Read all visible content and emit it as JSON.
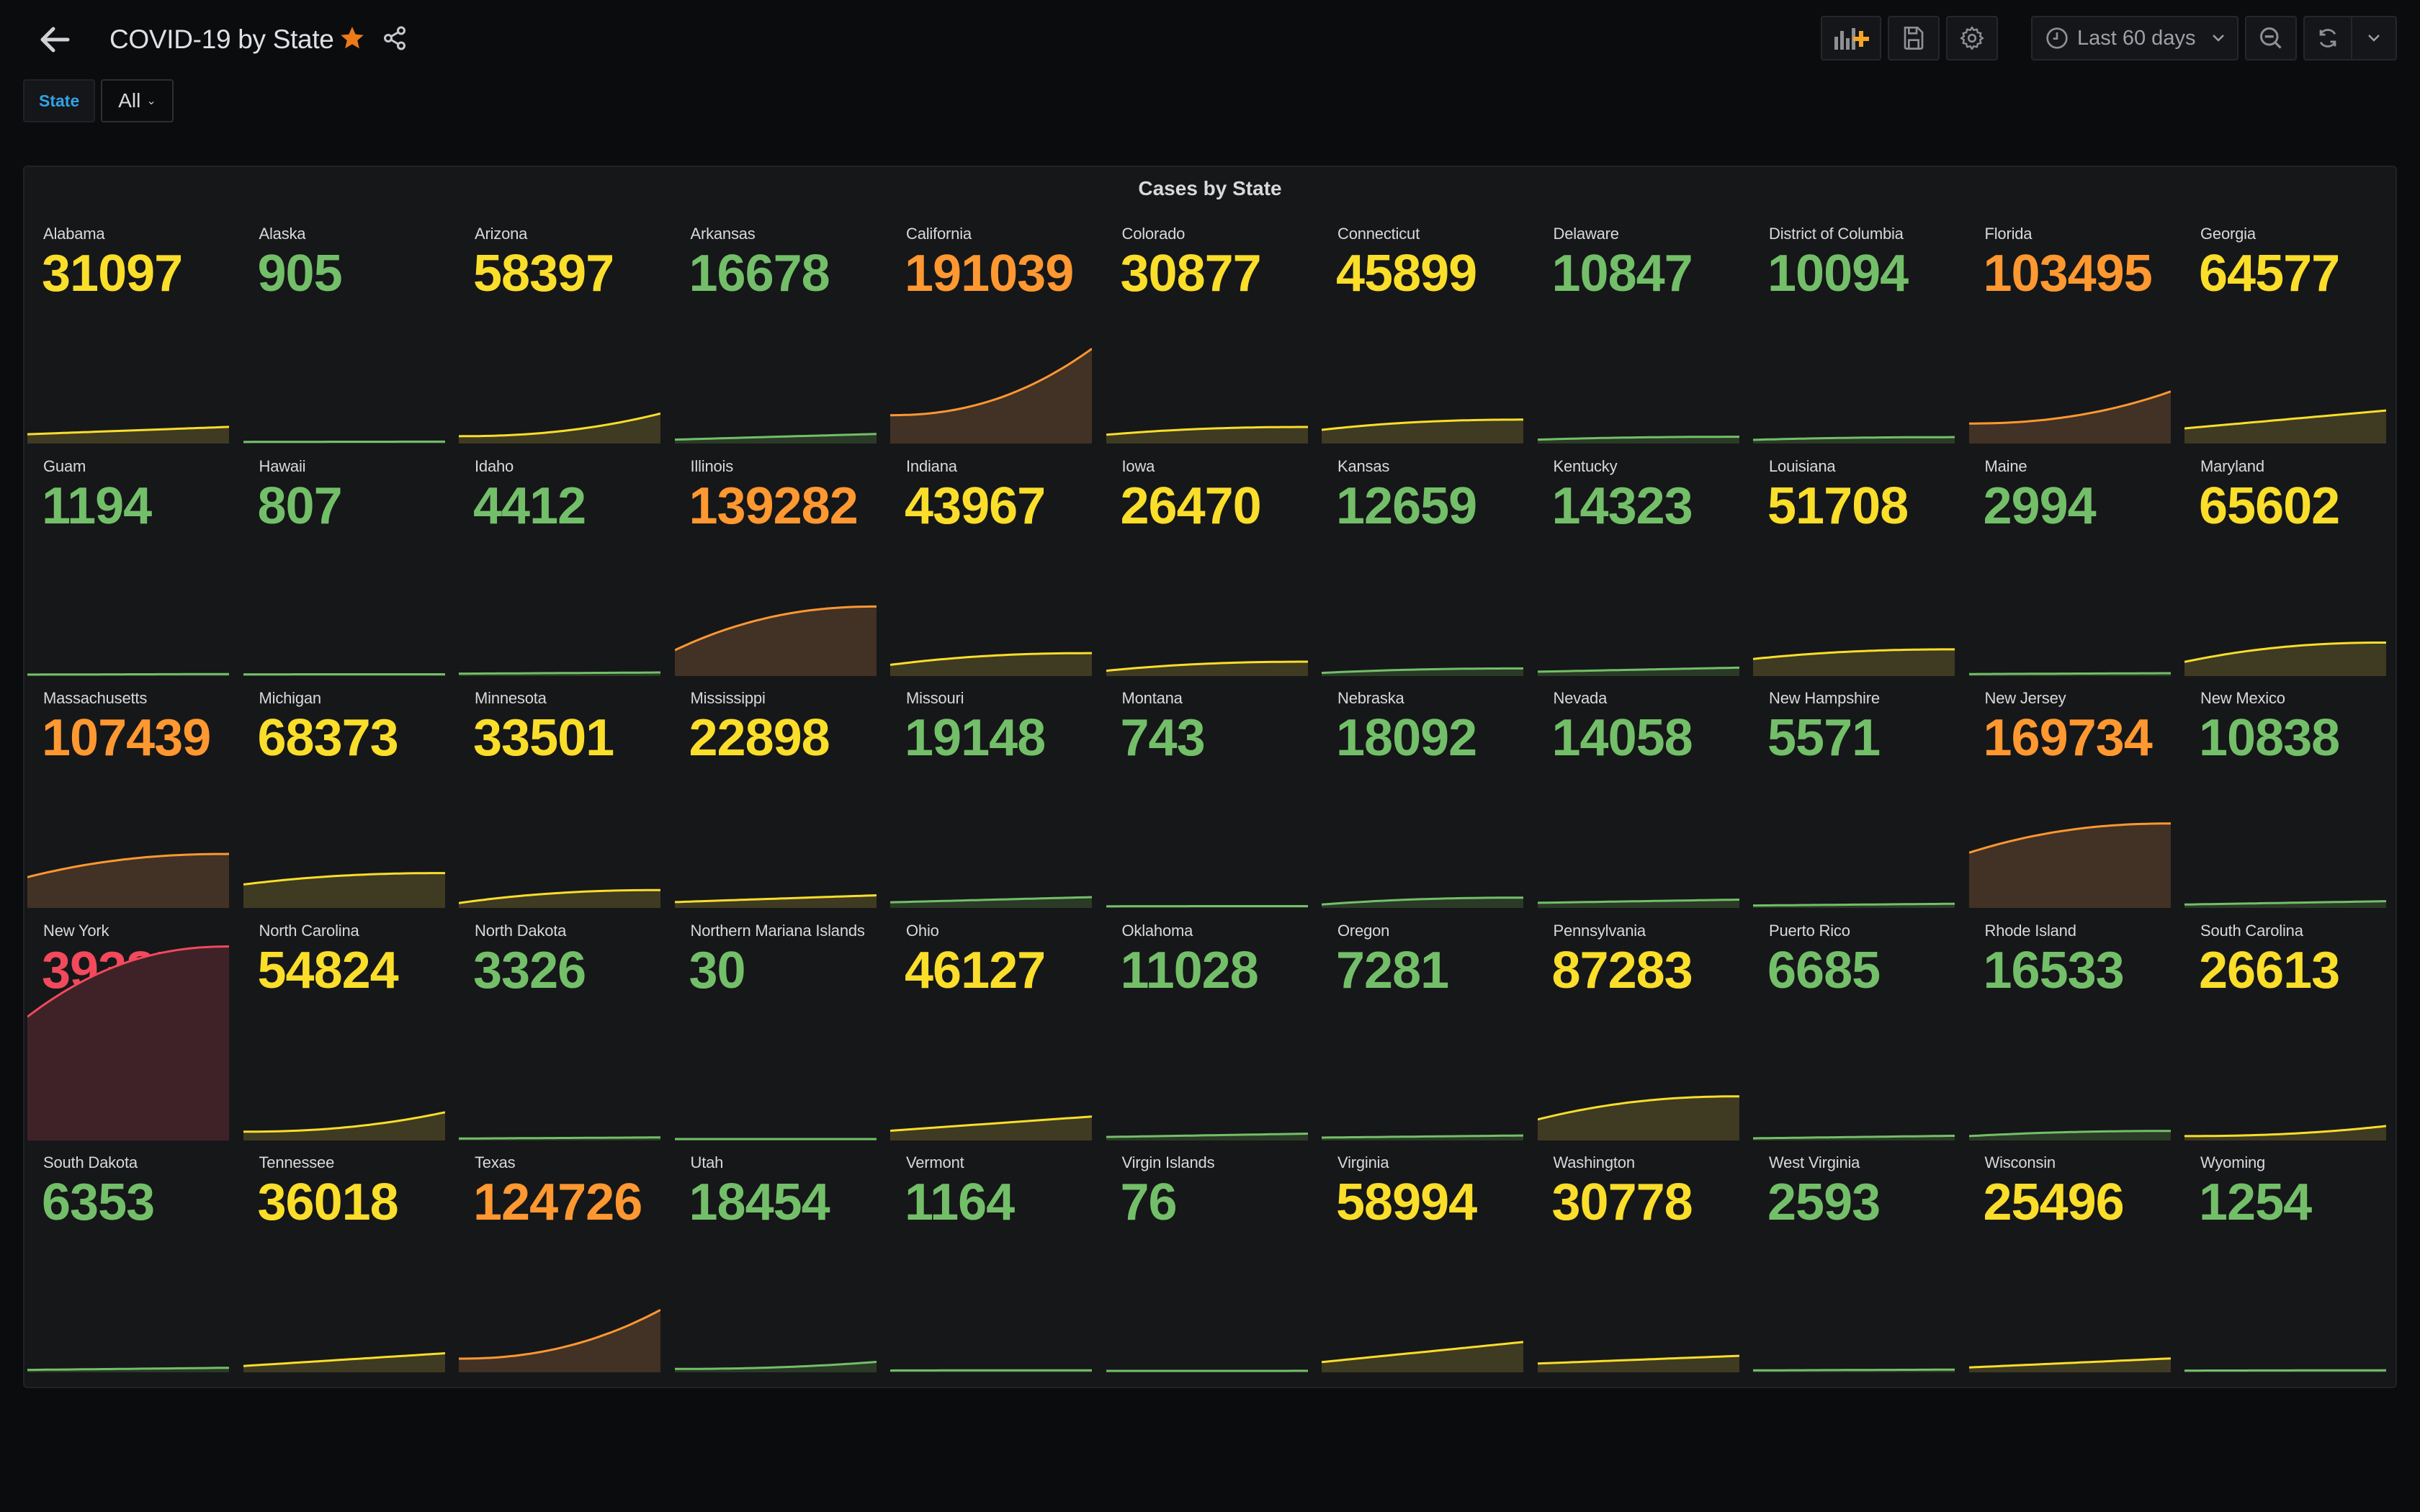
{
  "header": {
    "title": "COVID-19 by State",
    "back_icon": "arrow-left-icon",
    "starred": true,
    "star_color": "#eb7b18",
    "toolbar": {
      "add_panel_icon": "add-panel-icon",
      "save_icon": "save-icon",
      "settings_icon": "gear-icon",
      "time_range": "Last 60 days",
      "zoom_out_icon": "zoom-out-icon",
      "refresh_icon": "refresh-icon"
    }
  },
  "variables": [
    {
      "label": "State",
      "value": "All"
    }
  ],
  "panel": {
    "title": "Cases by State"
  },
  "colors": {
    "green": "#73bf69",
    "yellow": "#fade2a",
    "orange": "#ff9830",
    "red": "#f2495c"
  },
  "chart_data": {
    "type": "stat-sparkline-grid",
    "title": "Cases by State",
    "columns": 11,
    "sparkline_ymax": 430000,
    "series": [
      {
        "name": "Alabama",
        "value": 31097,
        "color": "yellow",
        "start": 16000,
        "shape": "linear"
      },
      {
        "name": "Alaska",
        "value": 905,
        "color": "green",
        "start": 500,
        "shape": "linear"
      },
      {
        "name": "Arizona",
        "value": 58397,
        "color": "yellow",
        "start": 12000,
        "shape": "convex"
      },
      {
        "name": "Arkansas",
        "value": 16678,
        "color": "green",
        "start": 5000,
        "shape": "linear"
      },
      {
        "name": "California",
        "value": 191039,
        "color": "orange",
        "start": 55000,
        "shape": "convex"
      },
      {
        "name": "Colorado",
        "value": 30877,
        "color": "yellow",
        "start": 15000,
        "shape": "concave"
      },
      {
        "name": "Connecticut",
        "value": 45899,
        "color": "yellow",
        "start": 25000,
        "shape": "concave"
      },
      {
        "name": "Delaware",
        "value": 10847,
        "color": "green",
        "start": 5000,
        "shape": "concave"
      },
      {
        "name": "District of Columbia",
        "value": 10094,
        "color": "green",
        "start": 4500,
        "shape": "concave"
      },
      {
        "name": "Florida",
        "value": 103495,
        "color": "orange",
        "start": 38000,
        "shape": "convex"
      },
      {
        "name": "Georgia",
        "value": 64577,
        "color": "yellow",
        "start": 28000,
        "shape": "linear"
      },
      {
        "name": "Guam",
        "value": 1194,
        "color": "green",
        "start": 150,
        "shape": "linear"
      },
      {
        "name": "Hawaii",
        "value": 807,
        "color": "green",
        "start": 620,
        "shape": "linear"
      },
      {
        "name": "Idaho",
        "value": 4412,
        "color": "green",
        "start": 2000,
        "shape": "linear"
      },
      {
        "name": "Illinois",
        "value": 139282,
        "color": "orange",
        "start": 50000,
        "shape": "concave"
      },
      {
        "name": "Indiana",
        "value": 43967,
        "color": "yellow",
        "start": 20000,
        "shape": "concave"
      },
      {
        "name": "Iowa",
        "value": 26470,
        "color": "yellow",
        "start": 8000,
        "shape": "concave"
      },
      {
        "name": "Kansas",
        "value": 12659,
        "color": "green",
        "start": 3500,
        "shape": "concave"
      },
      {
        "name": "Kentucky",
        "value": 14323,
        "color": "green",
        "start": 6000,
        "shape": "linear"
      },
      {
        "name": "Louisiana",
        "value": 51708,
        "color": "yellow",
        "start": 32000,
        "shape": "concave"
      },
      {
        "name": "Maine",
        "value": 2994,
        "color": "green",
        "start": 1200,
        "shape": "linear"
      },
      {
        "name": "Maryland",
        "value": 65602,
        "color": "yellow",
        "start": 26000,
        "shape": "concave"
      },
      {
        "name": "Massachusetts",
        "value": 107439,
        "color": "orange",
        "start": 60000,
        "shape": "concave"
      },
      {
        "name": "Michigan",
        "value": 68373,
        "color": "yellow",
        "start": 45000,
        "shape": "concave"
      },
      {
        "name": "Minnesota",
        "value": 33501,
        "color": "yellow",
        "start": 7000,
        "shape": "concave"
      },
      {
        "name": "Mississippi",
        "value": 22898,
        "color": "yellow",
        "start": 9000,
        "shape": "linear"
      },
      {
        "name": "Missouri",
        "value": 19148,
        "color": "green",
        "start": 8500,
        "shape": "linear"
      },
      {
        "name": "Montana",
        "value": 743,
        "color": "green",
        "start": 480,
        "shape": "concave"
      },
      {
        "name": "Nebraska",
        "value": 18092,
        "color": "green",
        "start": 4000,
        "shape": "concave"
      },
      {
        "name": "Nevada",
        "value": 14058,
        "color": "green",
        "start": 7500,
        "shape": "linear"
      },
      {
        "name": "New Hampshire",
        "value": 5571,
        "color": "green",
        "start": 2000,
        "shape": "linear"
      },
      {
        "name": "New Jersey",
        "value": 169734,
        "color": "orange",
        "start": 110000,
        "shape": "concave"
      },
      {
        "name": "New Mexico",
        "value": 10838,
        "color": "green",
        "start": 4000,
        "shape": "linear"
      },
      {
        "name": "New York",
        "value": 393855,
        "color": "red",
        "start": 250000,
        "shape": "concave"
      },
      {
        "name": "North Carolina",
        "value": 54824,
        "color": "yellow",
        "start": 15000,
        "shape": "convex"
      },
      {
        "name": "North Dakota",
        "value": 3326,
        "color": "green",
        "start": 1000,
        "shape": "linear"
      },
      {
        "name": "Northern Mariana Islands",
        "value": 30,
        "color": "green",
        "start": 14,
        "shape": "linear"
      },
      {
        "name": "Ohio",
        "value": 46127,
        "color": "yellow",
        "start": 17000,
        "shape": "linear"
      },
      {
        "name": "Oklahoma",
        "value": 11028,
        "color": "green",
        "start": 4200,
        "shape": "linear"
      },
      {
        "name": "Oregon",
        "value": 7281,
        "color": "green",
        "start": 3000,
        "shape": "linear"
      },
      {
        "name": "Pennsylvania",
        "value": 87283,
        "color": "yellow",
        "start": 40000,
        "shape": "concave"
      },
      {
        "name": "Puerto Rico",
        "value": 6685,
        "color": "green",
        "start": 1500,
        "shape": "linear"
      },
      {
        "name": "Rhode Island",
        "value": 16533,
        "color": "green",
        "start": 6000,
        "shape": "concave"
      },
      {
        "name": "South Carolina",
        "value": 26613,
        "color": "yellow",
        "start": 6000,
        "shape": "convex"
      },
      {
        "name": "South Dakota",
        "value": 6353,
        "color": "green",
        "start": 2000,
        "shape": "linear"
      },
      {
        "name": "Tennessee",
        "value": 36018,
        "color": "yellow",
        "start": 10000,
        "shape": "linear"
      },
      {
        "name": "Texas",
        "value": 124726,
        "color": "orange",
        "start": 25000,
        "shape": "convex"
      },
      {
        "name": "Utah",
        "value": 18454,
        "color": "green",
        "start": 4000,
        "shape": "convex"
      },
      {
        "name": "Vermont",
        "value": 1164,
        "color": "green",
        "start": 800,
        "shape": "concave"
      },
      {
        "name": "Virgin Islands",
        "value": 76,
        "color": "green",
        "start": 50,
        "shape": "linear"
      },
      {
        "name": "Virginia",
        "value": 58994,
        "color": "yellow",
        "start": 18000,
        "shape": "linear"
      },
      {
        "name": "Washington",
        "value": 30778,
        "color": "yellow",
        "start": 15000,
        "shape": "linear"
      },
      {
        "name": "West Virginia",
        "value": 2593,
        "color": "green",
        "start": 1000,
        "shape": "linear"
      },
      {
        "name": "Wisconsin",
        "value": 25496,
        "color": "yellow",
        "start": 7000,
        "shape": "linear"
      },
      {
        "name": "Wyoming",
        "value": 1254,
        "color": "green",
        "start": 600,
        "shape": "linear"
      }
    ]
  }
}
